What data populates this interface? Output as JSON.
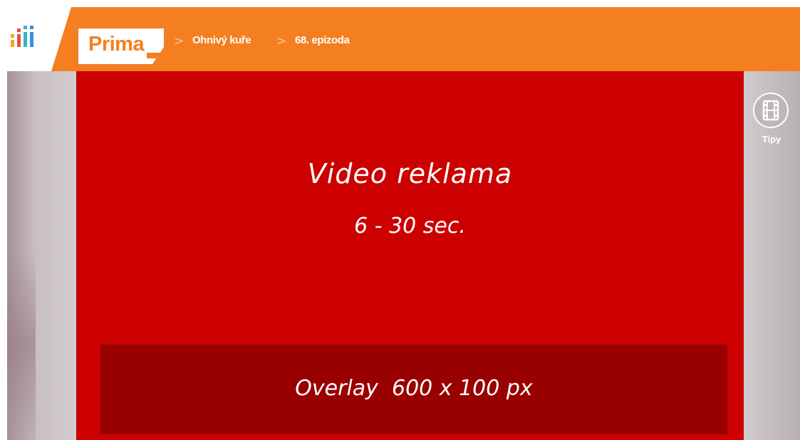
{
  "header": {
    "accent_color": "#f47f20",
    "brand_logo_text": "Prima",
    "stats_icon": "stats-bars-icon",
    "breadcrumbs": [
      {
        "label": "Ohnivý kuře"
      },
      {
        "label": "68. epizoda"
      }
    ],
    "separator_icon": "chevron-right-icon"
  },
  "ad": {
    "background_color": "#cc0000",
    "title": "Video reklama",
    "duration": "6 - 30 sec.",
    "overlay_color": "#990000",
    "overlay_text": "Overlay  600 x 100 px"
  },
  "sidebar_right": {
    "tips_icon": "film-strip-icon",
    "tips_label": "Tipy"
  }
}
